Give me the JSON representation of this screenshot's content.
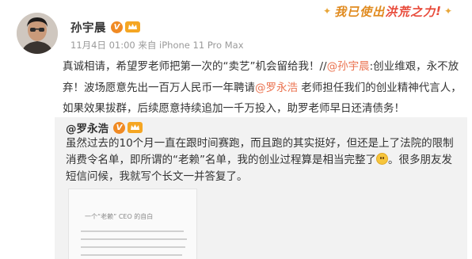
{
  "post": {
    "author": "孙宇晨",
    "v_badge": "V",
    "meta": "11月4日 01:00 来自 iPhone 11 Pro Max",
    "text": [
      {
        "t": "真诚相请，希望罗老师把第一次的“卖艺”机会留给我！//"
      },
      {
        "t": "@孙宇晨",
        "mention": true
      },
      {
        "t": ":创业维艰，永不放弃！波场愿意先出一百万人民币一年聘请"
      },
      {
        "t": "@罗永浩",
        "mention": true
      },
      {
        "t": " 老师担任我们的创业精神代言人，如果效果拔群，后续愿意持续追加一千万投入，助罗老师早日还清债务！"
      }
    ]
  },
  "sticker": {
    "text_1": "我已使出",
    "text_2": "洪荒之力",
    "exclaim": "!",
    "colors": {
      "text_1": "#e08a1e",
      "text_2": "#e84a3a"
    }
  },
  "repost": {
    "author": "@罗永浩",
    "v_badge": "V",
    "text_before_emoji": "虽然过去的10个月一直在跟时间赛跑，而且跑的其实挺好，但还是上了法院的限制消费令名单，即所谓的“老赖”名单，我的创业过程算是相当完整了",
    "emoji": "smiley-emoji",
    "text_after_emoji": "。很多朋友发短信问候，我就写个长文一并答复了。",
    "image": {
      "title": "一个“老赖” CEO 的自白"
    }
  },
  "colors": {
    "mention": "#eb7350",
    "repost_bg": "#f2f2f2",
    "v_badge": "#f08a24",
    "meta": "#9a9a9a"
  }
}
